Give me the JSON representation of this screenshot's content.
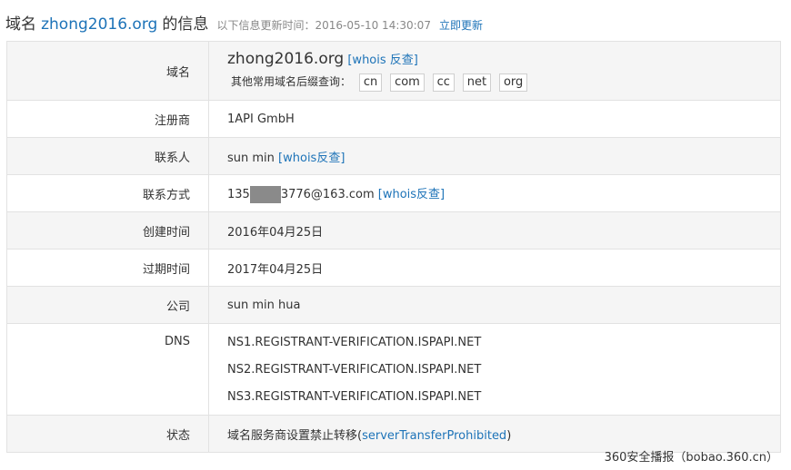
{
  "header": {
    "prefix": "域名",
    "domain": "zhong2016.org",
    "suffix": "的信息",
    "update_text": "以下信息更新时间：2016-05-10 14:30:07",
    "update_link": "立即更新"
  },
  "rows": {
    "domain": {
      "label": "域名",
      "value": "zhong2016.org",
      "whois_link": "[whois 反查]",
      "suffix_label": "其他常用域名后缀查询：",
      "suffixes": [
        "cn",
        "com",
        "cc",
        "net",
        "org"
      ]
    },
    "registrar": {
      "label": "注册商",
      "value": "1API GmbH"
    },
    "contact": {
      "label": "联系人",
      "value": "sun min",
      "whois_link": "[whois反查]"
    },
    "email": {
      "label": "联系方式",
      "value_prefix": "135",
      "value_suffix": "3776@163.com",
      "whois_link": "[whois反查]"
    },
    "created": {
      "label": "创建时间",
      "value": "2016年04月25日"
    },
    "expires": {
      "label": "过期时间",
      "value": "2017年04月25日"
    },
    "company": {
      "label": "公司",
      "value": "sun min hua"
    },
    "dns": {
      "label": "DNS",
      "servers": [
        "NS1.REGISTRANT-VERIFICATION.ISPAPI.NET",
        "NS2.REGISTRANT-VERIFICATION.ISPAPI.NET",
        "NS3.REGISTRANT-VERIFICATION.ISPAPI.NET"
      ]
    },
    "status": {
      "label": "状态",
      "value_prefix": "域名服务商设置禁止转移(",
      "value_link": "serverTransferProhibited",
      "value_suffix": ")"
    }
  },
  "watermark": "360安全播报（bobao.360.cn）"
}
